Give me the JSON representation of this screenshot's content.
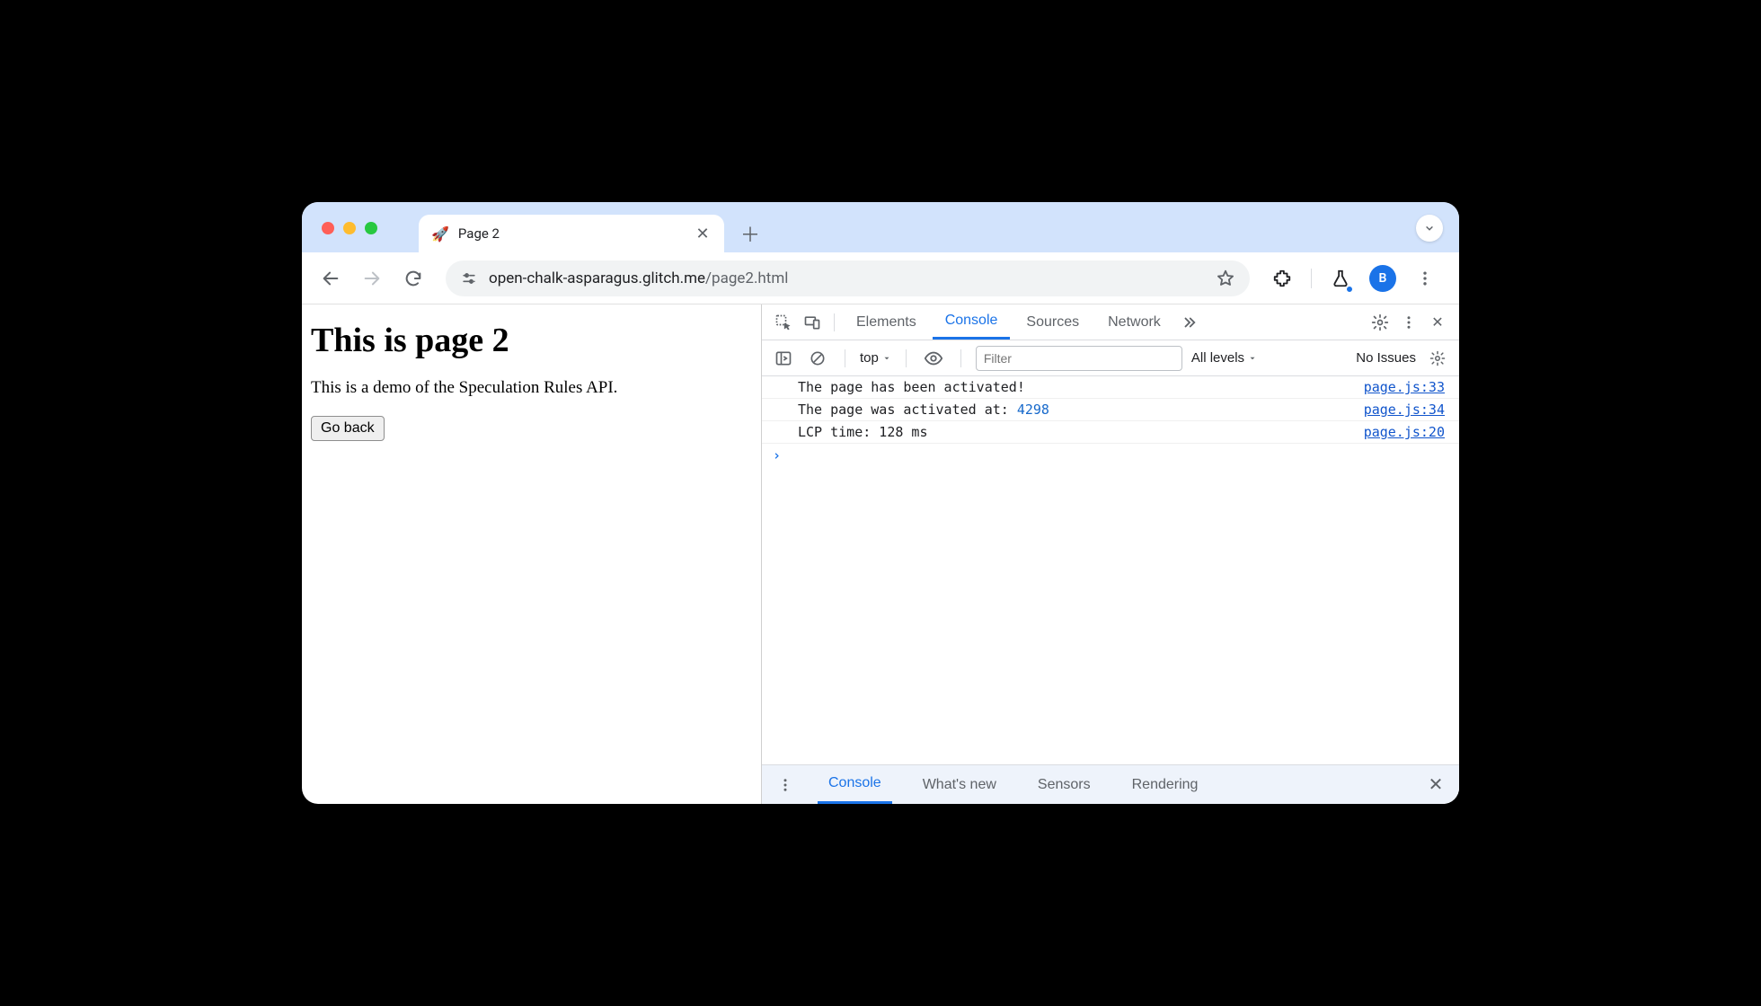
{
  "browser": {
    "tab_title": "Page 2",
    "favicon": "🚀",
    "url_domain": "open-chalk-asparagus.glitch.me",
    "url_path": "/page2.html",
    "avatar_initial": "B"
  },
  "page": {
    "heading": "This is page 2",
    "paragraph": "This is a demo of the Speculation Rules API.",
    "back_button": "Go back"
  },
  "devtools": {
    "tabs": {
      "elements": "Elements",
      "console": "Console",
      "sources": "Sources",
      "network": "Network"
    },
    "subbar": {
      "context": "top",
      "filter_placeholder": "Filter",
      "levels": "All levels",
      "no_issues": "No Issues"
    },
    "logs": [
      {
        "msg": "The page has been activated!",
        "src": "page.js:33"
      },
      {
        "msg": "The page was activated at: ",
        "num": "4298",
        "src": "page.js:34"
      },
      {
        "msg": "LCP time: 128 ms",
        "src": "page.js:20"
      }
    ],
    "drawer": {
      "console": "Console",
      "whatsnew": "What's new",
      "sensors": "Sensors",
      "rendering": "Rendering"
    }
  }
}
